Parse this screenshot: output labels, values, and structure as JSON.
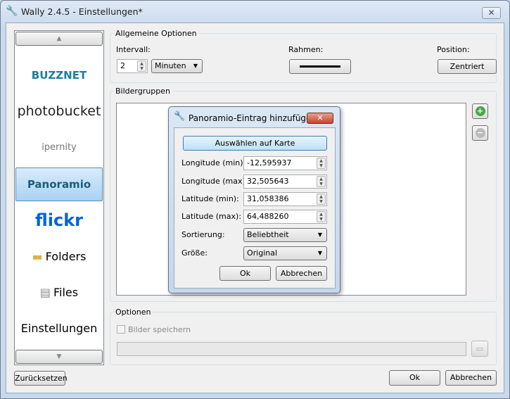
{
  "window": {
    "title": "Wally 2.4.5 - Einstellungen*",
    "close": "✕"
  },
  "sidebar": {
    "up": "▲",
    "down": "▼",
    "items": [
      {
        "label": "BUZZNET",
        "color": "#1a7ea0"
      },
      {
        "label": "photobucket",
        "color": "#222"
      },
      {
        "label": "ipernity",
        "color": "#777"
      },
      {
        "label": "Panoramio",
        "color": "#1a5e78"
      },
      {
        "label": "flickr",
        "color": "#0063dc"
      },
      {
        "label": "Folders",
        "color": "#111"
      },
      {
        "label": "Files",
        "color": "#111"
      },
      {
        "label": "Einstellungen",
        "color": "#111"
      }
    ],
    "selected": "Panoramio"
  },
  "general": {
    "title": "Allgemeine Optionen",
    "interval_label": "Intervall:",
    "interval_value": "2",
    "unit": "Minuten",
    "frame_label": "Rahmen:",
    "position_label": "Position:",
    "position_value": "Zentriert"
  },
  "groups": {
    "title": "Bildergruppen",
    "add": "+",
    "remove": "−"
  },
  "dialog": {
    "title": "Panoramio-Eintrag hinzufügen",
    "close": "✕",
    "map_button": "Auswählen auf Karte",
    "fields": [
      {
        "label": "Longitude (min):",
        "value": "-12,595937"
      },
      {
        "label": "Longitude (max):",
        "value": "32,505643"
      },
      {
        "label": "Latitude (min):",
        "value": "31,058386"
      },
      {
        "label": "Latitude (max):",
        "value": "64,488260"
      }
    ],
    "sort_label": "Sortierung:",
    "sort_value": "Beliebtheit",
    "size_label": "Größe:",
    "size_value": "Original",
    "ok": "Ok",
    "cancel": "Abbrechen"
  },
  "options": {
    "title": "Optionen",
    "save_label": "Bilder speichern",
    "path_value": ""
  },
  "footer": {
    "reset": "Zurücksetzen",
    "ok": "Ok",
    "cancel": "Abbrechen"
  }
}
